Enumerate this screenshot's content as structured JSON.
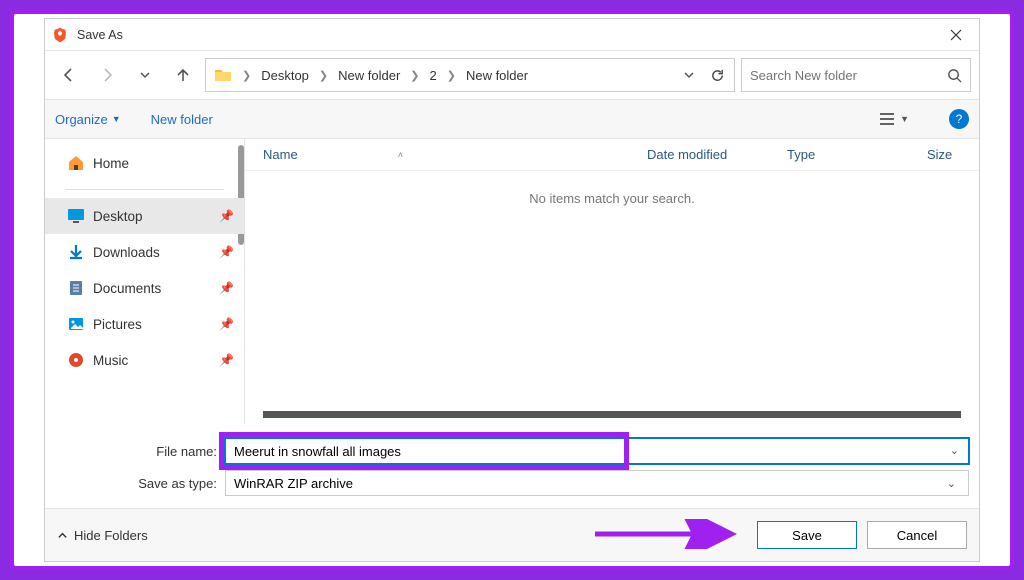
{
  "title": "Save As",
  "breadcrumb": [
    "Desktop",
    "New folder",
    "2",
    "New folder"
  ],
  "search": {
    "placeholder": "Search New folder"
  },
  "toolbar": {
    "organize": "Organize",
    "newfolder": "New folder"
  },
  "columns": {
    "name": "Name",
    "date": "Date modified",
    "type": "Type",
    "size": "Size"
  },
  "sidebar": [
    {
      "label": "Home",
      "icon": "home",
      "pinned": false
    },
    {
      "label": "Desktop",
      "icon": "desktop",
      "pinned": true,
      "active": true
    },
    {
      "label": "Downloads",
      "icon": "downloads",
      "pinned": true
    },
    {
      "label": "Documents",
      "icon": "documents",
      "pinned": true
    },
    {
      "label": "Pictures",
      "icon": "pictures",
      "pinned": true
    },
    {
      "label": "Music",
      "icon": "music",
      "pinned": true
    }
  ],
  "empty_msg": "No items match your search.",
  "filename_label": "File name:",
  "filename_value": "Meerut in snowfall all images",
  "savetype_label": "Save as type:",
  "savetype_value": "WinRAR ZIP archive",
  "hide_folders": "Hide Folders",
  "buttons": {
    "save": "Save",
    "cancel": "Cancel"
  }
}
